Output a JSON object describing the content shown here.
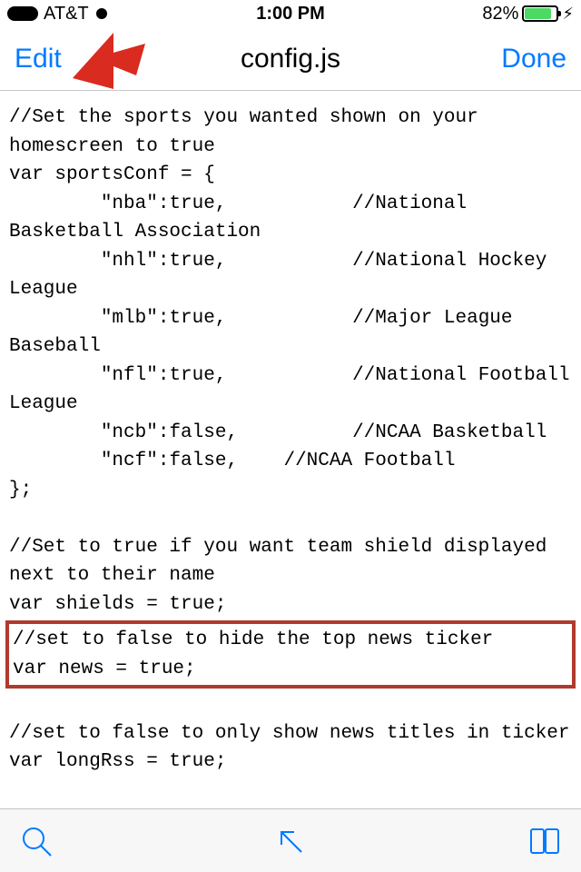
{
  "statusbar": {
    "carrier": "AT&T",
    "time": "1:00 PM",
    "battery_pct": "82%",
    "charging_glyph": "⚡︎"
  },
  "navbar": {
    "left": "Edit",
    "title": "config.js",
    "right": "Done"
  },
  "code": {
    "block1": "//Set the sports you wanted shown on your homescreen to true\nvar sportsConf = {\n        \"nba\":true,           //National Basketball Association\n        \"nhl\":true,           //National Hockey League\n        \"mlb\":true,           //Major League Baseball\n        \"nfl\":true,           //National Football League\n        \"ncb\":false,          //NCAA Basketball\n        \"ncf\":false,    //NCAA Football\n};\n\n//Set to true if you want team shield displayed next to their name\nvar shields = true;\n",
    "highlight": "//set to false to hide the top news ticker\nvar news = true;",
    "block2": "\n//set to false to only show news titles in ticker\nvar longRss = true;"
  },
  "annotation": {
    "arrow_color": "#d92b1f"
  }
}
